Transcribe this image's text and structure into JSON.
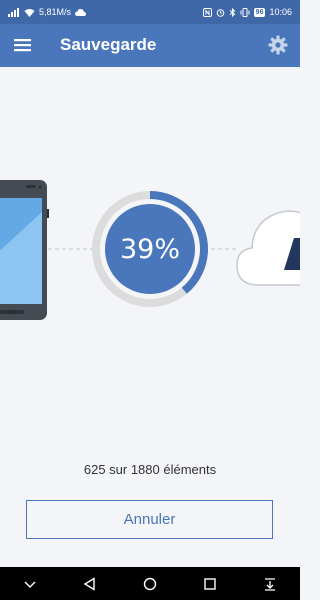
{
  "status_bar": {
    "network_speed": "5,81M/s",
    "battery": "96",
    "time": "10:06"
  },
  "app_bar": {
    "title": "Sauvegarde",
    "menu_icon": "hamburger-menu-icon",
    "settings_icon": "gear-icon"
  },
  "backup": {
    "progress_text": "39%",
    "progress_value": 0.39,
    "count_text": "625 sur 1880 éléments",
    "cancel_label": "Annuler"
  },
  "colors": {
    "primary": "#4a76bb",
    "status_bar": "#3f68a8",
    "background": "#f3f5f9",
    "progress_track": "#dcdcdc"
  },
  "nav_bar": {
    "buttons": [
      "chevron-down-icon",
      "back-triangle-icon",
      "home-circle-icon",
      "recents-square-icon",
      "download-icon"
    ]
  }
}
